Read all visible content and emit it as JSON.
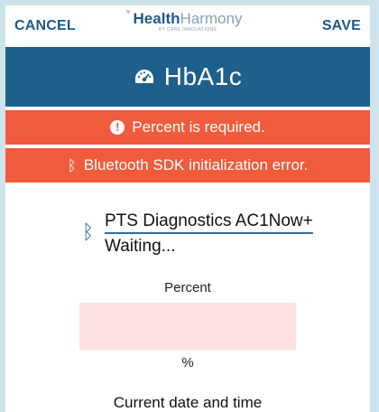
{
  "header": {
    "cancel_label": "CANCEL",
    "save_label": "SAVE",
    "brand_primary": "Health",
    "brand_secondary": "Harmony",
    "brand_tagline": "BY CARE INNOVATIONS"
  },
  "titlebar": {
    "icon": "gauge-icon",
    "title": "HbA1c",
    "color": "#1f5f8b"
  },
  "alerts": [
    {
      "icon": "exclamation-icon",
      "text": "Percent is required."
    },
    {
      "icon": "bluetooth-icon",
      "text": "Bluetooth SDK initialization error."
    }
  ],
  "alert_color": "#f05b3c",
  "device": {
    "icon": "bluetooth-icon",
    "name": "PTS Diagnostics AC1Now+",
    "status": "Waiting..."
  },
  "percent_field": {
    "label": "Percent",
    "value": "",
    "unit": "%"
  },
  "section": {
    "label": "Current date and time"
  }
}
